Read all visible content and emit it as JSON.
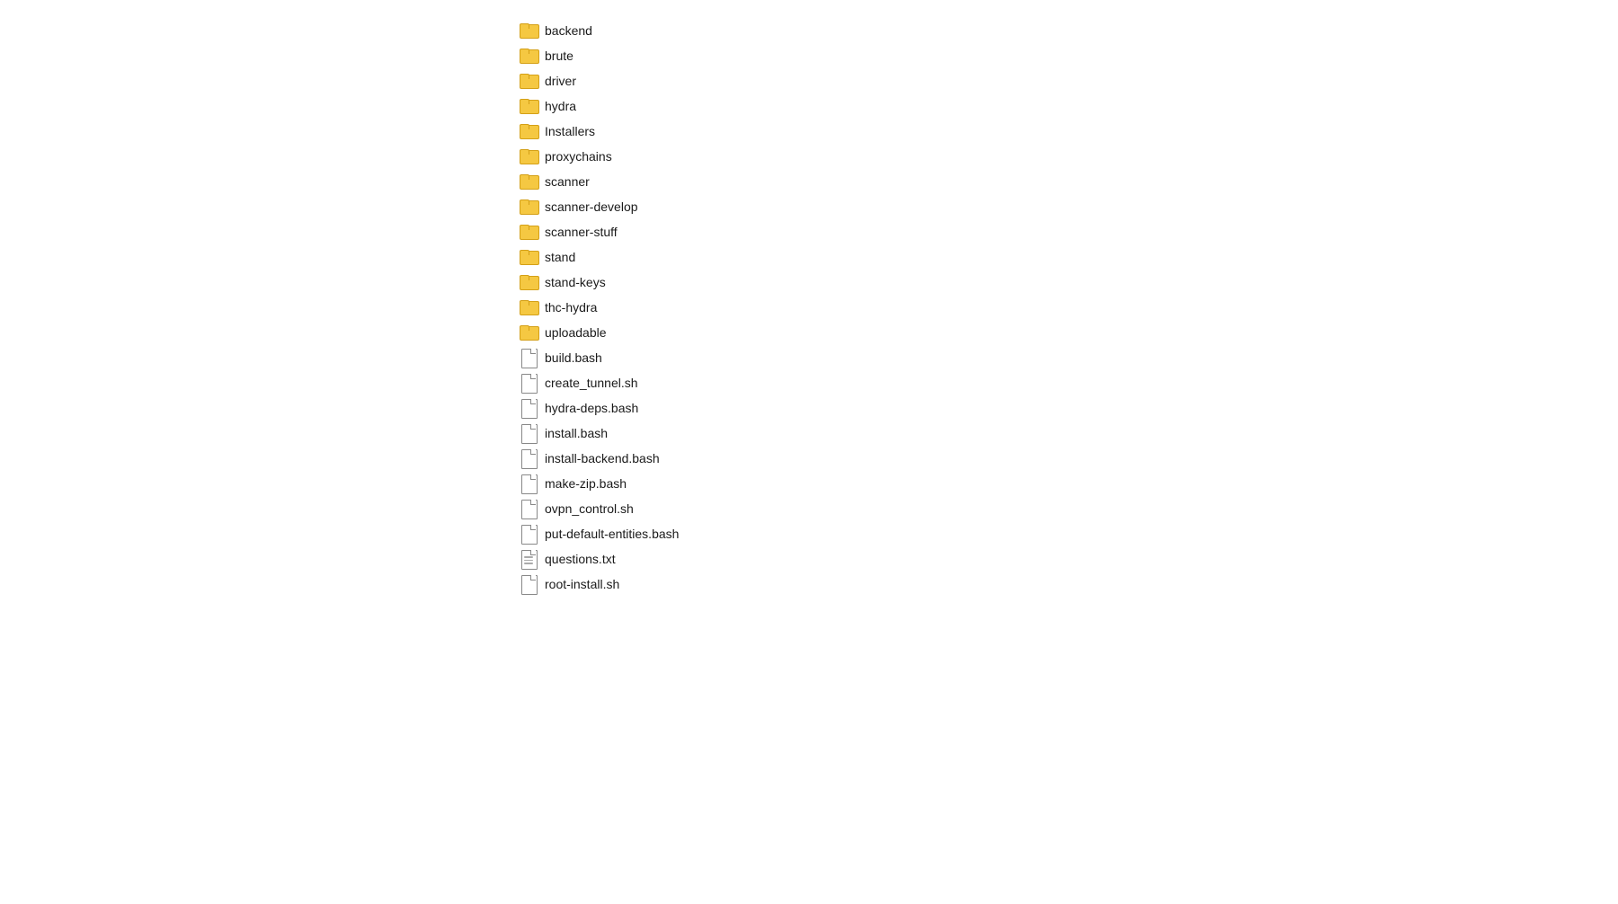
{
  "fileList": {
    "folders": [
      {
        "name": "backend",
        "type": "folder"
      },
      {
        "name": "brute",
        "type": "folder"
      },
      {
        "name": "driver",
        "type": "folder"
      },
      {
        "name": "hydra",
        "type": "folder"
      },
      {
        "name": "Installers",
        "type": "folder"
      },
      {
        "name": "proxychains",
        "type": "folder"
      },
      {
        "name": "scanner",
        "type": "folder"
      },
      {
        "name": "scanner-develop",
        "type": "folder"
      },
      {
        "name": "scanner-stuff",
        "type": "folder"
      },
      {
        "name": "stand",
        "type": "folder"
      },
      {
        "name": "stand-keys",
        "type": "folder"
      },
      {
        "name": "thc-hydra",
        "type": "folder"
      },
      {
        "name": "uploadable",
        "type": "folder"
      }
    ],
    "files": [
      {
        "name": "build.bash",
        "type": "file"
      },
      {
        "name": "create_tunnel.sh",
        "type": "file"
      },
      {
        "name": "hydra-deps.bash",
        "type": "file"
      },
      {
        "name": "install.bash",
        "type": "file"
      },
      {
        "name": "install-backend.bash",
        "type": "file"
      },
      {
        "name": "make-zip.bash",
        "type": "file"
      },
      {
        "name": "ovpn_control.sh",
        "type": "file"
      },
      {
        "name": "put-default-entities.bash",
        "type": "file"
      },
      {
        "name": "questions.txt",
        "type": "txt"
      },
      {
        "name": "root-install.sh",
        "type": "file"
      }
    ]
  }
}
